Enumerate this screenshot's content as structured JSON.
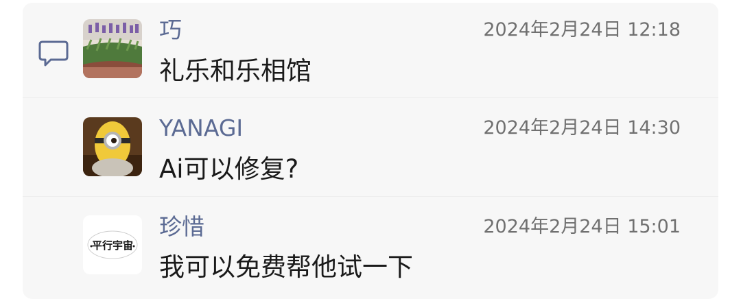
{
  "comments": [
    {
      "author": "巧",
      "timestamp": "2024年2月24日 12:18",
      "text": "礼乐和乐相馆",
      "avatar": "flower-garden-photo"
    },
    {
      "author": "YANAGI",
      "timestamp": "2024年2月24日 14:30",
      "text": "Ai可以修复?",
      "avatar": "minion-toy-photo"
    },
    {
      "author": "珍惜",
      "timestamp": "2024年2月24日 15:01",
      "text": "我可以免费帮他试一下",
      "avatar": "平行宇宙"
    }
  ],
  "icons": {
    "comment": "comment-bubble-icon"
  },
  "colors": {
    "name": "#5b6a93",
    "time": "#707070",
    "text": "#1a1a1a",
    "panel": "#f7f7f7",
    "icon": "#5b6a93"
  }
}
